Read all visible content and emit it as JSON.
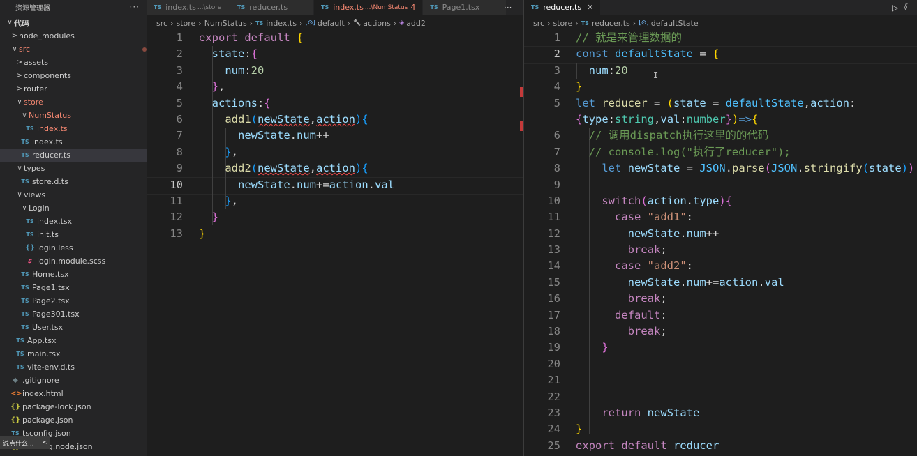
{
  "explorer": {
    "title": "资源管理器",
    "more": "···",
    "items": [
      {
        "label": "代码",
        "chev": "∨",
        "kind": "folder",
        "depth": 0,
        "bold": true
      },
      {
        "label": "node_modules",
        "chev": ">",
        "kind": "folder",
        "depth": 1
      },
      {
        "label": "src",
        "chev": "∨",
        "kind": "folder",
        "depth": 1,
        "mod": "err",
        "dot": true
      },
      {
        "label": "assets",
        "chev": ">",
        "kind": "folder",
        "depth": 2
      },
      {
        "label": "components",
        "chev": ">",
        "kind": "folder",
        "depth": 2
      },
      {
        "label": "router",
        "chev": ">",
        "kind": "folder",
        "depth": 2
      },
      {
        "label": "store",
        "chev": "∨",
        "kind": "folder",
        "depth": 2,
        "mod": "err",
        "dot": true
      },
      {
        "label": "NumStatus",
        "chev": "∨",
        "kind": "folder",
        "depth": 3,
        "mod": "err",
        "dot": true
      },
      {
        "label": "index.ts",
        "kind": "ts",
        "depth": 4,
        "mod": "err",
        "badge": "4"
      },
      {
        "label": "index.ts",
        "kind": "ts",
        "depth": 3
      },
      {
        "label": "reducer.ts",
        "kind": "ts",
        "depth": 3,
        "selected": true
      },
      {
        "label": "types",
        "chev": "∨",
        "kind": "folder",
        "depth": 2
      },
      {
        "label": "store.d.ts",
        "kind": "ts",
        "depth": 3
      },
      {
        "label": "views",
        "chev": "∨",
        "kind": "folder",
        "depth": 2
      },
      {
        "label": "Login",
        "chev": "∨",
        "kind": "folder",
        "depth": 3
      },
      {
        "label": "index.tsx",
        "kind": "ts",
        "depth": 4
      },
      {
        "label": "init.ts",
        "kind": "ts",
        "depth": 4
      },
      {
        "label": "login.less",
        "kind": "less",
        "depth": 4
      },
      {
        "label": "login.module.scss",
        "kind": "scss",
        "depth": 4
      },
      {
        "label": "Home.tsx",
        "kind": "ts",
        "depth": 3
      },
      {
        "label": "Page1.tsx",
        "kind": "ts",
        "depth": 3
      },
      {
        "label": "Page2.tsx",
        "kind": "ts",
        "depth": 3
      },
      {
        "label": "Page301.tsx",
        "kind": "ts",
        "depth": 3
      },
      {
        "label": "User.tsx",
        "kind": "ts",
        "depth": 3
      },
      {
        "label": "App.tsx",
        "kind": "ts",
        "depth": 2
      },
      {
        "label": "main.tsx",
        "kind": "ts",
        "depth": 2
      },
      {
        "label": "vite-env.d.ts",
        "kind": "ts",
        "depth": 2
      },
      {
        "label": ".gitignore",
        "kind": "git",
        "depth": 1
      },
      {
        "label": "index.html",
        "kind": "html",
        "depth": 1
      },
      {
        "label": "package-lock.json",
        "kind": "json",
        "depth": 1
      },
      {
        "label": "package.json",
        "kind": "json",
        "depth": 1
      },
      {
        "label": "tsconfig.json",
        "kind": "ts",
        "depth": 1
      },
      {
        "label": "tsconfig.node.json",
        "kind": "json",
        "depth": 1
      }
    ],
    "tooltip": {
      "text": "说点什么...",
      "arrow": "<"
    }
  },
  "icons": {
    "ts": "TS",
    "json": "{}",
    "html": "<>",
    "less": "{}",
    "scss": "𝘴",
    "git": "◆"
  },
  "left_tabs": [
    {
      "name": "index.ts",
      "desc": "...\\store"
    },
    {
      "name": "reducer.ts",
      "desc": ""
    },
    {
      "name": "index.ts",
      "desc": "...\\NumStatus",
      "count": "4",
      "active": true,
      "err": true
    },
    {
      "name": "Page1.tsx",
      "desc": ""
    }
  ],
  "left_tab_more": "···",
  "right_tabs": [
    {
      "name": "reducer.ts",
      "active": true,
      "close": "✕"
    }
  ],
  "right_tab_actions": {
    "run": "▷",
    "split": "⫽"
  },
  "left_breadcrumb": [
    {
      "text": "src"
    },
    {
      "text": "store"
    },
    {
      "text": "NumStatus"
    },
    {
      "text": "index.ts",
      "icon": "ts"
    },
    {
      "text": "default",
      "icon": "sym"
    },
    {
      "text": "actions",
      "icon": "wrench"
    },
    {
      "text": "add2",
      "icon": "method"
    }
  ],
  "right_breadcrumb": [
    {
      "text": "src"
    },
    {
      "text": "store"
    },
    {
      "text": "reducer.ts",
      "icon": "ts"
    },
    {
      "text": "defaultState",
      "icon": "sym"
    }
  ],
  "left_editor": {
    "current_line": 10,
    "lines": [
      [
        [
          "kw2",
          "export "
        ],
        [
          "kw2",
          "default "
        ],
        [
          "p1",
          "{"
        ]
      ],
      [
        [
          "plain",
          "  "
        ],
        [
          "var",
          "state"
        ],
        [
          "plain",
          ":"
        ],
        [
          "p2",
          "{"
        ]
      ],
      [
        [
          "plain",
          "    "
        ],
        [
          "var",
          "num"
        ],
        [
          "plain",
          ":"
        ],
        [
          "num",
          "20"
        ]
      ],
      [
        [
          "plain",
          "  "
        ],
        [
          "p2",
          "}"
        ],
        [
          "plain",
          ","
        ]
      ],
      [
        [
          "plain",
          "  "
        ],
        [
          "var",
          "actions"
        ],
        [
          "plain",
          ":"
        ],
        [
          "p2",
          "{"
        ]
      ],
      [
        [
          "plain",
          "    "
        ],
        [
          "fn",
          "add1"
        ],
        [
          "p3",
          "("
        ],
        [
          "var",
          "newState",
          "sq"
        ],
        [
          "plain",
          ","
        ],
        [
          "var",
          "action",
          "sq"
        ],
        [
          "p3",
          ")"
        ],
        [
          "p3",
          "{"
        ]
      ],
      [
        [
          "plain",
          "      "
        ],
        [
          "var",
          "newState"
        ],
        [
          "plain",
          "."
        ],
        [
          "var",
          "num"
        ],
        [
          "plain",
          "++"
        ]
      ],
      [
        [
          "plain",
          "    "
        ],
        [
          "p3",
          "}"
        ],
        [
          "plain",
          ","
        ]
      ],
      [
        [
          "plain",
          "    "
        ],
        [
          "fn",
          "add2"
        ],
        [
          "p3",
          "("
        ],
        [
          "var",
          "newState",
          "sq"
        ],
        [
          "plain",
          ","
        ],
        [
          "var",
          "action",
          "sq"
        ],
        [
          "p3",
          ")"
        ],
        [
          "p3",
          "{"
        ]
      ],
      [
        [
          "plain",
          "      "
        ],
        [
          "var",
          "newState"
        ],
        [
          "plain",
          "."
        ],
        [
          "var",
          "num"
        ],
        [
          "plain",
          "+="
        ],
        [
          "var",
          "action"
        ],
        [
          "plain",
          "."
        ],
        [
          "var",
          "val"
        ]
      ],
      [
        [
          "plain",
          "    "
        ],
        [
          "p3",
          "}"
        ],
        [
          "plain",
          ","
        ]
      ],
      [
        [
          "plain",
          "  "
        ],
        [
          "p2",
          "}"
        ]
      ],
      [
        [
          "p1",
          "}"
        ]
      ]
    ]
  },
  "right_editor": {
    "current_line": 2,
    "lines": [
      {
        "n": "1",
        "t": [
          [
            "cmt",
            "// 就是来管理数据的"
          ]
        ]
      },
      {
        "n": "2",
        "t": [
          [
            "kw",
            "const "
          ],
          [
            "const",
            "defaultState"
          ],
          [
            "plain",
            " = "
          ],
          [
            "p1",
            "{"
          ]
        ]
      },
      {
        "n": "3",
        "t": [
          [
            "plain",
            "  "
          ],
          [
            "var",
            "num"
          ],
          [
            "plain",
            ":"
          ],
          [
            "num",
            "20"
          ]
        ]
      },
      {
        "n": "4",
        "t": [
          [
            "p1",
            "}"
          ]
        ]
      },
      {
        "n": "5",
        "t": [
          [
            "kw",
            "let "
          ],
          [
            "fn",
            "reducer"
          ],
          [
            "plain",
            " = "
          ],
          [
            "p1",
            "("
          ],
          [
            "var",
            "state"
          ],
          [
            "plain",
            " = "
          ],
          [
            "const",
            "defaultState"
          ],
          [
            "plain",
            ","
          ],
          [
            "var",
            "action"
          ],
          [
            "plain",
            ":"
          ]
        ]
      },
      {
        "n": "",
        "t": [
          [
            "p2",
            "{"
          ],
          [
            "var",
            "type"
          ],
          [
            "plain",
            ":"
          ],
          [
            "type",
            "string"
          ],
          [
            "plain",
            ","
          ],
          [
            "var",
            "val"
          ],
          [
            "plain",
            ":"
          ],
          [
            "type",
            "number"
          ],
          [
            "p2",
            "}"
          ],
          [
            "p1",
            ")"
          ],
          [
            "kw",
            "=>"
          ],
          [
            "p1",
            "{"
          ]
        ]
      },
      {
        "n": "6",
        "t": [
          [
            "plain",
            "  "
          ],
          [
            "cmt",
            "// 调用dispatch执行这里的的代码"
          ]
        ]
      },
      {
        "n": "7",
        "t": [
          [
            "plain",
            "  "
          ],
          [
            "cmt",
            "// console.log(\"执行了reducer\");"
          ]
        ]
      },
      {
        "n": "8",
        "t": [
          [
            "plain",
            "    "
          ],
          [
            "kw",
            "let "
          ],
          [
            "var",
            "newState"
          ],
          [
            "plain",
            " = "
          ],
          [
            "const",
            "JSON"
          ],
          [
            "plain",
            "."
          ],
          [
            "fn",
            "parse"
          ],
          [
            "p2",
            "("
          ],
          [
            "const",
            "JSON"
          ],
          [
            "plain",
            "."
          ],
          [
            "fn",
            "stringify"
          ],
          [
            "p3",
            "("
          ],
          [
            "var",
            "state"
          ],
          [
            "p3",
            ")"
          ],
          [
            "p2",
            ")"
          ]
        ]
      },
      {
        "n": "9",
        "t": []
      },
      {
        "n": "10",
        "t": [
          [
            "plain",
            "    "
          ],
          [
            "kw2",
            "switch"
          ],
          [
            "p2",
            "("
          ],
          [
            "var",
            "action"
          ],
          [
            "plain",
            "."
          ],
          [
            "var",
            "type"
          ],
          [
            "p2",
            ")"
          ],
          [
            "p2",
            "{"
          ]
        ]
      },
      {
        "n": "11",
        "t": [
          [
            "plain",
            "      "
          ],
          [
            "kw2",
            "case "
          ],
          [
            "str",
            "\"add1\""
          ],
          [
            "plain",
            ":"
          ]
        ]
      },
      {
        "n": "12",
        "t": [
          [
            "plain",
            "        "
          ],
          [
            "var",
            "newState"
          ],
          [
            "plain",
            "."
          ],
          [
            "var",
            "num"
          ],
          [
            "plain",
            "++"
          ]
        ]
      },
      {
        "n": "13",
        "t": [
          [
            "plain",
            "        "
          ],
          [
            "kw2",
            "break"
          ],
          [
            "plain",
            ";"
          ]
        ]
      },
      {
        "n": "14",
        "t": [
          [
            "plain",
            "      "
          ],
          [
            "kw2",
            "case "
          ],
          [
            "str",
            "\"add2\""
          ],
          [
            "plain",
            ":"
          ]
        ]
      },
      {
        "n": "15",
        "t": [
          [
            "plain",
            "        "
          ],
          [
            "var",
            "newState"
          ],
          [
            "plain",
            "."
          ],
          [
            "var",
            "num"
          ],
          [
            "plain",
            "+="
          ],
          [
            "var",
            "action"
          ],
          [
            "plain",
            "."
          ],
          [
            "var",
            "val"
          ]
        ]
      },
      {
        "n": "16",
        "t": [
          [
            "plain",
            "        "
          ],
          [
            "kw2",
            "break"
          ],
          [
            "plain",
            ";"
          ]
        ]
      },
      {
        "n": "17",
        "t": [
          [
            "plain",
            "      "
          ],
          [
            "kw2",
            "default"
          ],
          [
            "plain",
            ":"
          ]
        ]
      },
      {
        "n": "18",
        "t": [
          [
            "plain",
            "        "
          ],
          [
            "kw2",
            "break"
          ],
          [
            "plain",
            ";"
          ]
        ]
      },
      {
        "n": "19",
        "t": [
          [
            "plain",
            "    "
          ],
          [
            "p2",
            "}"
          ]
        ]
      },
      {
        "n": "20",
        "t": []
      },
      {
        "n": "21",
        "t": []
      },
      {
        "n": "22",
        "t": []
      },
      {
        "n": "23",
        "t": [
          [
            "plain",
            "    "
          ],
          [
            "kw2",
            "return "
          ],
          [
            "var",
            "newState"
          ]
        ]
      },
      {
        "n": "24",
        "t": [
          [
            "p1",
            "}"
          ]
        ]
      },
      {
        "n": "25",
        "t": [
          [
            "kw2",
            "export "
          ],
          [
            "kw2",
            "default "
          ],
          [
            "var",
            "reducer"
          ]
        ]
      }
    ]
  }
}
